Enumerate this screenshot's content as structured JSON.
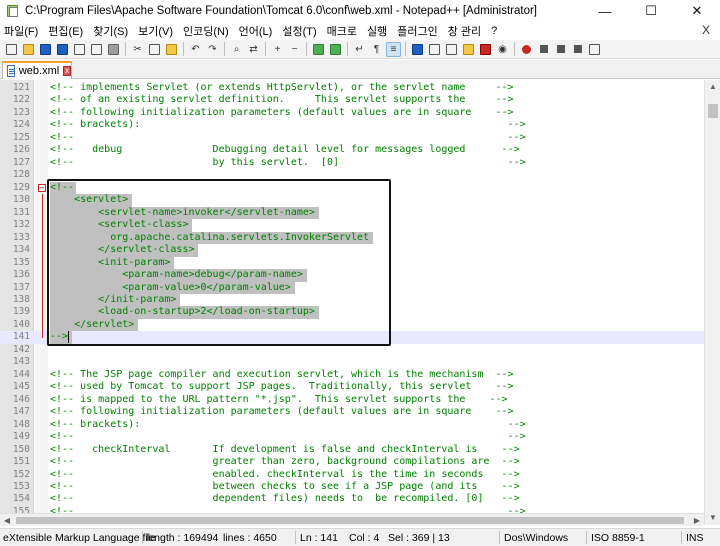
{
  "window": {
    "title": "C:\\Program Files\\Apache Software Foundation\\Tomcat 6.0\\conf\\web.xml - Notepad++ [Administrator]",
    "minimize": "—",
    "maximize": "☐",
    "close": "✕"
  },
  "menu": {
    "items": [
      "파일(F)",
      "편집(E)",
      "찾기(S)",
      "보기(V)",
      "인코딩(N)",
      "언어(L)",
      "설정(T)",
      "매크로",
      "실행",
      "플러그인",
      "창 관리",
      "?"
    ],
    "close_glyph": "X"
  },
  "tab": {
    "label": "web.xml",
    "close_glyph": "x"
  },
  "editor": {
    "lines": [
      {
        "n": "121",
        "text": "<!-- implements Servlet (or extends HttpServlet), or the servlet name     -->"
      },
      {
        "n": "122",
        "text": "<!-- of an existing servlet definition.     This servlet supports the     -->"
      },
      {
        "n": "123",
        "text": "<!-- following initialization parameters (default values are in square    -->"
      },
      {
        "n": "124",
        "text": "<!-- brackets):                                                             -->"
      },
      {
        "n": "125",
        "text": "<!--                                                                        -->"
      },
      {
        "n": "126",
        "text": "<!--   debug               Debugging detail level for messages logged      -->"
      },
      {
        "n": "127",
        "text": "<!--                       by this servlet.  [0]                            -->"
      },
      {
        "n": "128",
        "text": ""
      },
      {
        "n": "129",
        "text": "<!--"
      },
      {
        "n": "130",
        "text": "    <servlet>"
      },
      {
        "n": "131",
        "text": "        <servlet-name>invoker</servlet-name>"
      },
      {
        "n": "132",
        "text": "        <servlet-class>"
      },
      {
        "n": "133",
        "text": "          org.apache.catalina.servlets.InvokerServlet"
      },
      {
        "n": "134",
        "text": "        </servlet-class>"
      },
      {
        "n": "135",
        "text": "        <init-param>"
      },
      {
        "n": "136",
        "text": "            <param-name>debug</param-name>"
      },
      {
        "n": "137",
        "text": "            <param-value>0</param-value>"
      },
      {
        "n": "138",
        "text": "        </init-param>"
      },
      {
        "n": "139",
        "text": "        <load-on-startup>2</load-on-startup>"
      },
      {
        "n": "140",
        "text": "    </servlet>"
      },
      {
        "n": "141",
        "text": "-->"
      },
      {
        "n": "142",
        "text": ""
      },
      {
        "n": "143",
        "text": ""
      },
      {
        "n": "144",
        "text": "<!-- The JSP page compiler and execution servlet, which is the mechanism  -->"
      },
      {
        "n": "145",
        "text": "<!-- used by Tomcat to support JSP pages.  Traditionally, this servlet    -->"
      },
      {
        "n": "146",
        "text": "<!-- is mapped to the URL pattern \"*.jsp\".  This servlet supports the    -->"
      },
      {
        "n": "147",
        "text": "<!-- following initialization parameters (default values are in square    -->"
      },
      {
        "n": "148",
        "text": "<!-- brackets):                                                             -->"
      },
      {
        "n": "149",
        "text": "<!--                                                                        -->"
      },
      {
        "n": "150",
        "text": "<!--   checkInterval       If development is false and checkInterval is    -->"
      },
      {
        "n": "151",
        "text": "<!--                       greater than zero, background compilations are  -->"
      },
      {
        "n": "152",
        "text": "<!--                       enabled. checkInterval is the time in seconds   -->"
      },
      {
        "n": "153",
        "text": "<!--                       between checks to see if a JSP page (and its    -->"
      },
      {
        "n": "154",
        "text": "<!--                       dependent files) needs to  be recompiled. [0]   -->"
      },
      {
        "n": "155",
        "text": "<!--                                                                        -->"
      }
    ]
  },
  "status": {
    "file_type": "eXtensible Markup Language file",
    "length": "length : 169494",
    "lines": "lines : 4650",
    "ln": "Ln : 141",
    "col": "Col : 4",
    "sel": "Sel : 369 | 13",
    "eol": "Dos\\Windows",
    "encoding": "ISO 8859-1",
    "mode": "INS"
  }
}
